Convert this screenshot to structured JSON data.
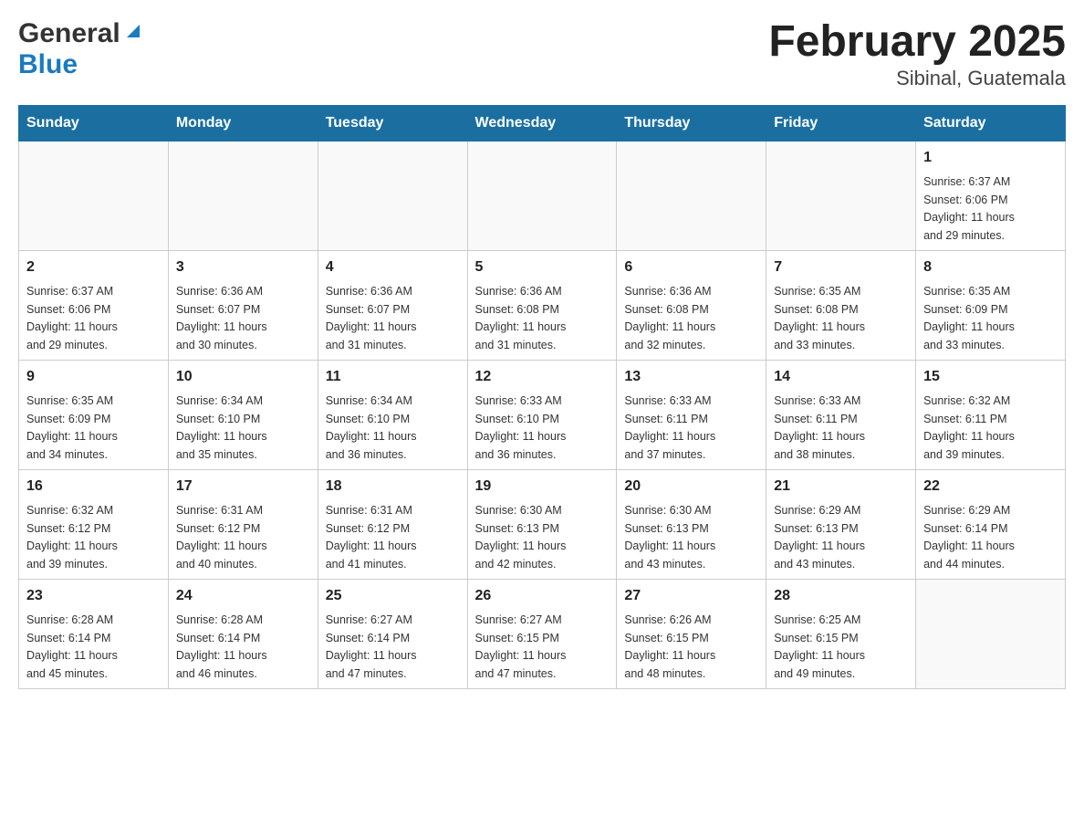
{
  "header": {
    "logo_general": "General",
    "logo_blue": "Blue",
    "title": "February 2025",
    "subtitle": "Sibinal, Guatemala"
  },
  "calendar": {
    "days_of_week": [
      "Sunday",
      "Monday",
      "Tuesday",
      "Wednesday",
      "Thursday",
      "Friday",
      "Saturday"
    ],
    "weeks": [
      [
        {
          "day": "",
          "info": ""
        },
        {
          "day": "",
          "info": ""
        },
        {
          "day": "",
          "info": ""
        },
        {
          "day": "",
          "info": ""
        },
        {
          "day": "",
          "info": ""
        },
        {
          "day": "",
          "info": ""
        },
        {
          "day": "1",
          "info": "Sunrise: 6:37 AM\nSunset: 6:06 PM\nDaylight: 11 hours\nand 29 minutes."
        }
      ],
      [
        {
          "day": "2",
          "info": "Sunrise: 6:37 AM\nSunset: 6:06 PM\nDaylight: 11 hours\nand 29 minutes."
        },
        {
          "day": "3",
          "info": "Sunrise: 6:36 AM\nSunset: 6:07 PM\nDaylight: 11 hours\nand 30 minutes."
        },
        {
          "day": "4",
          "info": "Sunrise: 6:36 AM\nSunset: 6:07 PM\nDaylight: 11 hours\nand 31 minutes."
        },
        {
          "day": "5",
          "info": "Sunrise: 6:36 AM\nSunset: 6:08 PM\nDaylight: 11 hours\nand 31 minutes."
        },
        {
          "day": "6",
          "info": "Sunrise: 6:36 AM\nSunset: 6:08 PM\nDaylight: 11 hours\nand 32 minutes."
        },
        {
          "day": "7",
          "info": "Sunrise: 6:35 AM\nSunset: 6:08 PM\nDaylight: 11 hours\nand 33 minutes."
        },
        {
          "day": "8",
          "info": "Sunrise: 6:35 AM\nSunset: 6:09 PM\nDaylight: 11 hours\nand 33 minutes."
        }
      ],
      [
        {
          "day": "9",
          "info": "Sunrise: 6:35 AM\nSunset: 6:09 PM\nDaylight: 11 hours\nand 34 minutes."
        },
        {
          "day": "10",
          "info": "Sunrise: 6:34 AM\nSunset: 6:10 PM\nDaylight: 11 hours\nand 35 minutes."
        },
        {
          "day": "11",
          "info": "Sunrise: 6:34 AM\nSunset: 6:10 PM\nDaylight: 11 hours\nand 36 minutes."
        },
        {
          "day": "12",
          "info": "Sunrise: 6:33 AM\nSunset: 6:10 PM\nDaylight: 11 hours\nand 36 minutes."
        },
        {
          "day": "13",
          "info": "Sunrise: 6:33 AM\nSunset: 6:11 PM\nDaylight: 11 hours\nand 37 minutes."
        },
        {
          "day": "14",
          "info": "Sunrise: 6:33 AM\nSunset: 6:11 PM\nDaylight: 11 hours\nand 38 minutes."
        },
        {
          "day": "15",
          "info": "Sunrise: 6:32 AM\nSunset: 6:11 PM\nDaylight: 11 hours\nand 39 minutes."
        }
      ],
      [
        {
          "day": "16",
          "info": "Sunrise: 6:32 AM\nSunset: 6:12 PM\nDaylight: 11 hours\nand 39 minutes."
        },
        {
          "day": "17",
          "info": "Sunrise: 6:31 AM\nSunset: 6:12 PM\nDaylight: 11 hours\nand 40 minutes."
        },
        {
          "day": "18",
          "info": "Sunrise: 6:31 AM\nSunset: 6:12 PM\nDaylight: 11 hours\nand 41 minutes."
        },
        {
          "day": "19",
          "info": "Sunrise: 6:30 AM\nSunset: 6:13 PM\nDaylight: 11 hours\nand 42 minutes."
        },
        {
          "day": "20",
          "info": "Sunrise: 6:30 AM\nSunset: 6:13 PM\nDaylight: 11 hours\nand 43 minutes."
        },
        {
          "day": "21",
          "info": "Sunrise: 6:29 AM\nSunset: 6:13 PM\nDaylight: 11 hours\nand 43 minutes."
        },
        {
          "day": "22",
          "info": "Sunrise: 6:29 AM\nSunset: 6:14 PM\nDaylight: 11 hours\nand 44 minutes."
        }
      ],
      [
        {
          "day": "23",
          "info": "Sunrise: 6:28 AM\nSunset: 6:14 PM\nDaylight: 11 hours\nand 45 minutes."
        },
        {
          "day": "24",
          "info": "Sunrise: 6:28 AM\nSunset: 6:14 PM\nDaylight: 11 hours\nand 46 minutes."
        },
        {
          "day": "25",
          "info": "Sunrise: 6:27 AM\nSunset: 6:14 PM\nDaylight: 11 hours\nand 47 minutes."
        },
        {
          "day": "26",
          "info": "Sunrise: 6:27 AM\nSunset: 6:15 PM\nDaylight: 11 hours\nand 47 minutes."
        },
        {
          "day": "27",
          "info": "Sunrise: 6:26 AM\nSunset: 6:15 PM\nDaylight: 11 hours\nand 48 minutes."
        },
        {
          "day": "28",
          "info": "Sunrise: 6:25 AM\nSunset: 6:15 PM\nDaylight: 11 hours\nand 49 minutes."
        },
        {
          "day": "",
          "info": ""
        }
      ]
    ]
  }
}
